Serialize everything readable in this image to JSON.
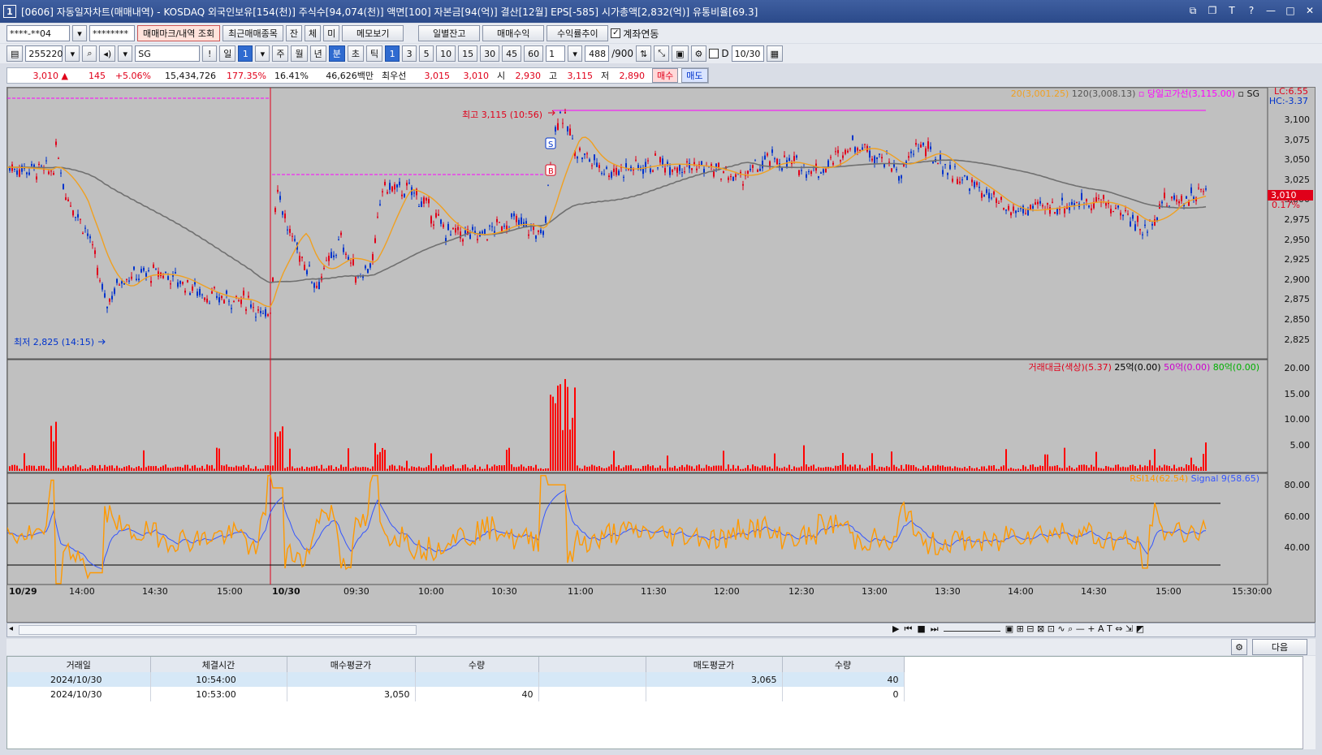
{
  "window": {
    "icon_label": "1",
    "title": "[0606] 자동일자차트(매매내역) - KOSDAQ 외국인보유[154(천)] 주식수[94,074(천)] 액면[100] 자본금[94(억)] 결산[12월] EPS[-585] 시가총액[2,832(억)] 유통비율[69.3]"
  },
  "toolbar1": {
    "account": "****-**04",
    "password": "********",
    "buttons": [
      "매매마크/내역 조회",
      "최근매매종목",
      "잔",
      "체",
      "미",
      "메모보기",
      "일별잔고",
      "매매수익",
      "수익률추이"
    ],
    "checkbox_label": "계좌연동"
  },
  "toolbar2": {
    "code": "255220",
    "name": "SG",
    "period_buttons": [
      "일",
      "1",
      "주",
      "월",
      "년",
      "분",
      "초",
      "틱"
    ],
    "minute_buttons": [
      "1",
      "3",
      "5",
      "10",
      "15",
      "30",
      "45",
      "60"
    ],
    "count_select": "1",
    "count": "488",
    "count_max": "/900",
    "date_checkbox": "D",
    "date": "10/30"
  },
  "quote": {
    "price": "3,010",
    "change": "145",
    "change_pct": "+5.06%",
    "volume": "15,434,726",
    "vol_ratio": "177.35%",
    "turnover": "16.41%",
    "amount": "46,626백만",
    "best_label": "최우선",
    "best_ask": "3,015",
    "best_bid": "3,010",
    "open_label": "시",
    "open": "2,930",
    "high_label": "고",
    "high": "3,115",
    "low_label": "저",
    "low": "2,890",
    "buy_btn": "매수",
    "sell_btn": "매도"
  },
  "price_pane": {
    "legend_ma20": "20(3,001.25)",
    "legend_ma120": "120(3,008.13)",
    "legend_high_line": "당일고가선(3,115.00)",
    "legend_sg": "SG",
    "lc": "LC:6.55",
    "hc": "HC:-3.37",
    "current_tag": "3,010",
    "current_pct": "0.17%",
    "max_label": "최고 3,115 (10:56)",
    "min_label": "최저 2,825 (14:15)",
    "y_ticks": [
      "3,100",
      "3,075",
      "3,050",
      "3,025",
      "3,000",
      "2,975",
      "2,950",
      "2,925",
      "2,900",
      "2,875",
      "2,850",
      "2,825"
    ],
    "buy_mark": "B",
    "sell_mark": "S"
  },
  "volume_pane": {
    "legend_main": "거래대금(색상)(5.37)",
    "legend_25": "25억(0.00)",
    "legend_50": "50억(0.00)",
    "legend_80": "80억(0.00)",
    "y_ticks": [
      "20.00",
      "15.00",
      "10.00",
      "5.00"
    ]
  },
  "rsi_pane": {
    "legend_rsi": "RSI14(62.54)",
    "legend_signal": "Signal 9(58.65)",
    "y_ticks": [
      "80.00",
      "60.00",
      "40.00"
    ]
  },
  "x_axis": {
    "labels": [
      "10/29",
      "14:00",
      "14:30",
      "15:00",
      "10/30",
      "09:30",
      "10:00",
      "10:30",
      "11:00",
      "11:30",
      "12:00",
      "12:30",
      "13:00",
      "13:30",
      "14:00",
      "14:30",
      "15:00",
      "15:30:00"
    ]
  },
  "bottom": {
    "next_btn": "다음"
  },
  "trades": {
    "headers": [
      "거래일",
      "체결시간",
      "매수평균가",
      "수량",
      "",
      "매도평균가",
      "수량"
    ],
    "rows": [
      [
        "2024/10/30",
        "10:54:00",
        "",
        "",
        "",
        "3,065",
        "40"
      ],
      [
        "2024/10/30",
        "10:53:00",
        "3,050",
        "40",
        "",
        "",
        "0"
      ]
    ]
  },
  "colors": {
    "up": "#e0001a",
    "down": "#0033cc",
    "ma20": "#f0a020",
    "ma120": "#707070",
    "high_line": "#ff00ff",
    "rsi": "#ff9900",
    "signal": "#3355ff"
  }
}
